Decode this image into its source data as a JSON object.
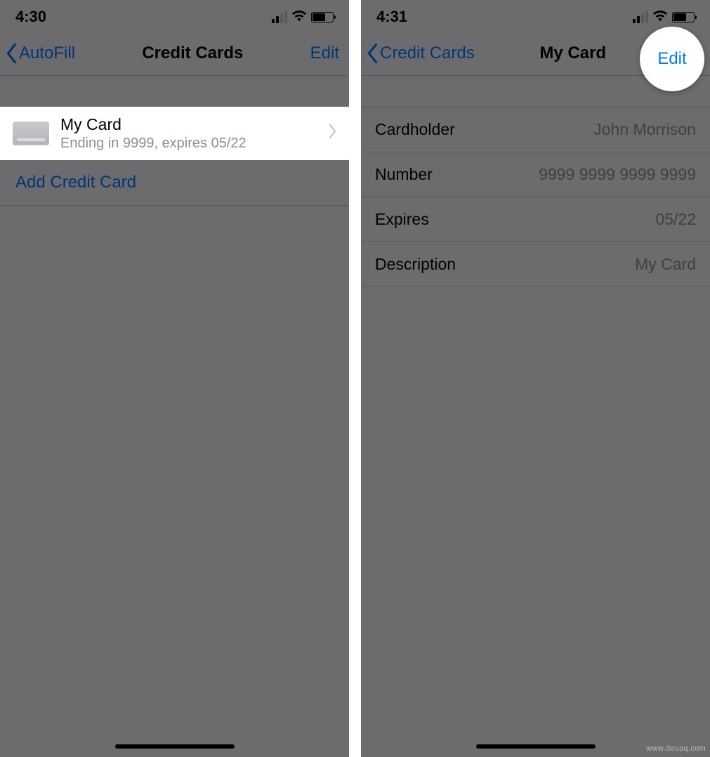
{
  "left": {
    "status": {
      "time": "4:30"
    },
    "nav": {
      "back_label": "AutoFill",
      "title": "Credit Cards",
      "action_label": "Edit"
    },
    "card": {
      "title": "My Card",
      "subtitle": "Ending in 9999, expires 05/22"
    },
    "add_label": "Add Credit Card"
  },
  "right": {
    "status": {
      "time": "4:31"
    },
    "nav": {
      "back_label": "Credit Cards",
      "title": "My Card",
      "action_label": "Edit"
    },
    "details": [
      {
        "label": "Cardholder",
        "value": "John Morrison"
      },
      {
        "label": "Number",
        "value": "9999 9999 9999 9999"
      },
      {
        "label": "Expires",
        "value": "05/22"
      },
      {
        "label": "Description",
        "value": "My Card"
      }
    ]
  },
  "watermark": "www.deuaq.com"
}
